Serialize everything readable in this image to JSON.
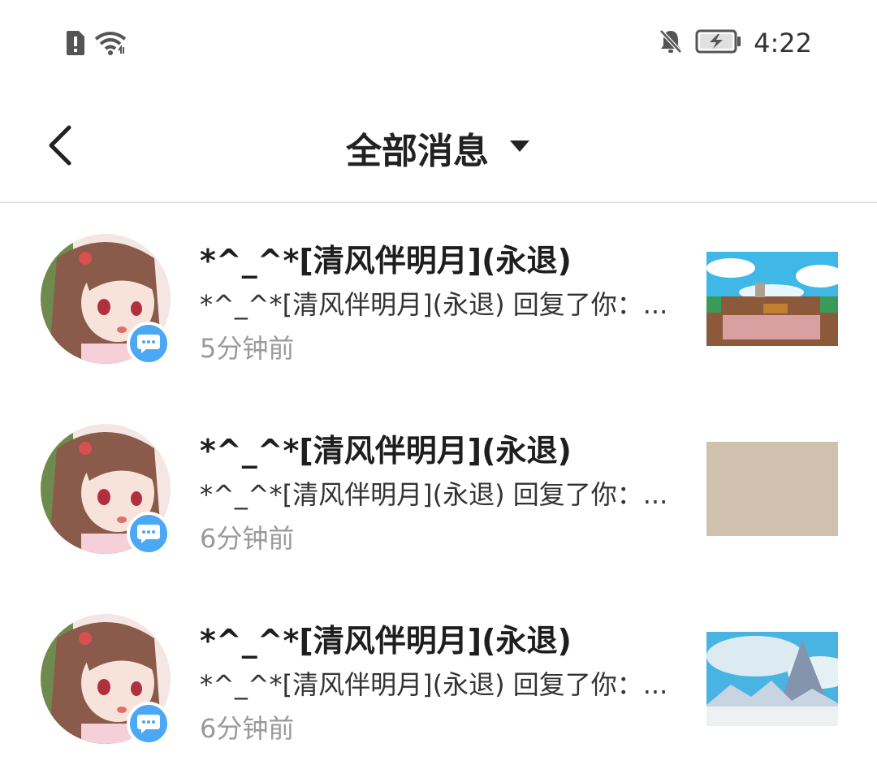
{
  "status_bar": {
    "time": "4:22",
    "icons": [
      "sim-alert-icon",
      "wifi-icon",
      "bell-off-icon",
      "battery-charging-icon"
    ]
  },
  "header": {
    "back_icon": "chevron-left-icon",
    "title": "全部消息",
    "dropdown_icon": "caret-down-icon"
  },
  "messages": [
    {
      "name": "*^_^*[清风伴明月](永退)",
      "preview": "*^_^*[清风伴明月](永退) 回复了你：...",
      "time": "5分钟前",
      "badge_icon": "chat-bubble-icon",
      "thumb": "sky-village-thumbnail"
    },
    {
      "name": "*^_^*[清风伴明月](永退)",
      "preview": "*^_^*[清风伴明月](永退) 回复了你：...",
      "time": "6分钟前",
      "badge_icon": "chat-bubble-icon",
      "thumb": "beige-thumbnail"
    },
    {
      "name": "*^_^*[清风伴明月](永退)",
      "preview": "*^_^*[清风伴明月](永退) 回复了你：...",
      "time": "6分钟前",
      "badge_icon": "chat-bubble-icon",
      "thumb": "snowy-mountain-thumbnail"
    }
  ],
  "colors": {
    "badge": "#4aa8f5",
    "time_text": "#9a9a9a",
    "divider": "#e6e6e6"
  }
}
